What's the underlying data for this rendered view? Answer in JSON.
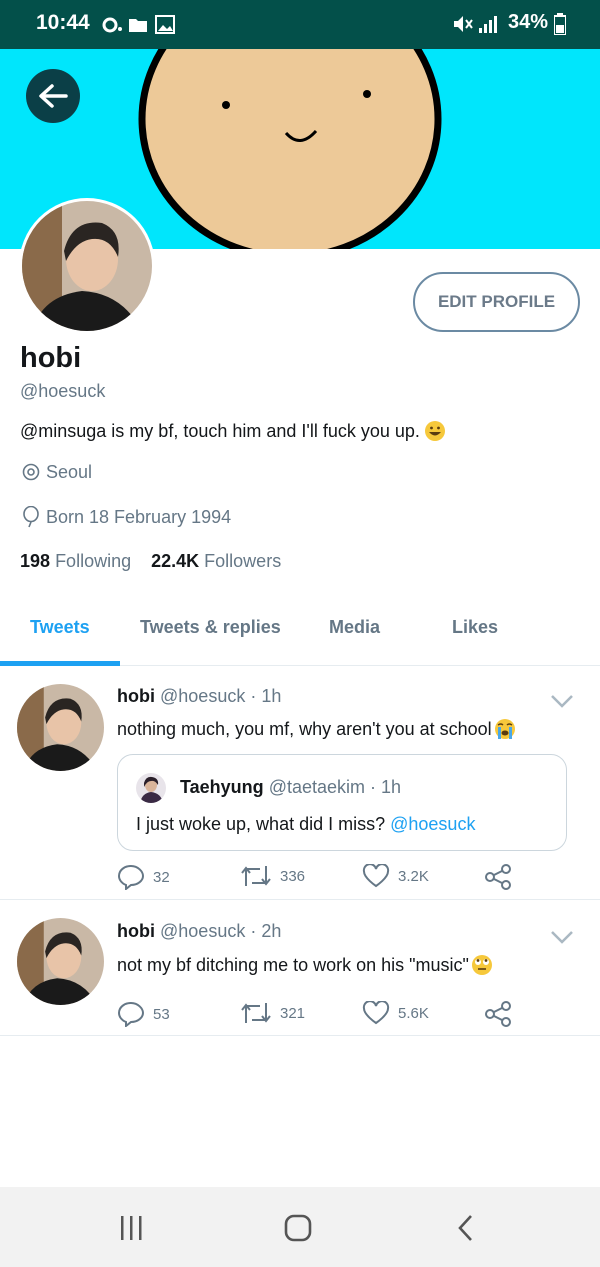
{
  "status_bar": {
    "time": "10:44",
    "battery": "34%"
  },
  "profile": {
    "name": "hobi",
    "handle": "@hoesuck",
    "bio": "@minsuga is my bf, touch him and I'll fuck you up.",
    "location": "Seoul",
    "born": "Born 18 February 1994",
    "following_count": "198",
    "following_label": "Following",
    "followers_count": "22.4K",
    "followers_label": "Followers",
    "edit_label": "EDIT PROFILE"
  },
  "tabs": [
    {
      "label": "Tweets",
      "active": true
    },
    {
      "label": "Tweets & replies"
    },
    {
      "label": "Media"
    },
    {
      "label": "Likes"
    }
  ],
  "tweets": [
    {
      "name": "hobi",
      "handle": "@hoesuck · 1h",
      "text": "nothing much, you mf, why aren't you at school",
      "quote": {
        "name": "Taehyung",
        "handle": "@taetaekim · 1h",
        "text": "I just woke up, what did I miss?",
        "mention": "@hoesuck"
      },
      "replies": "32",
      "retweets": "336",
      "likes": "3.2K"
    },
    {
      "name": "hobi",
      "handle": "@hoesuck · 2h",
      "text": "not my bf ditching me to work on his \"music\"",
      "replies": "53",
      "retweets": "321",
      "likes": "5.6K"
    }
  ],
  "colors": {
    "accent": "#1da1f2",
    "status_bar": "#03504a",
    "banner": "#00e6fc"
  }
}
